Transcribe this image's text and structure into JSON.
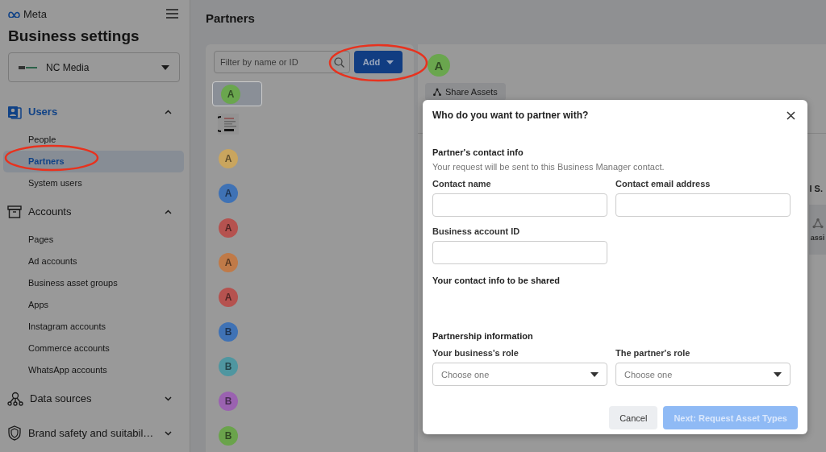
{
  "sidebar": {
    "logo": "Meta",
    "title": "Business settings",
    "business_selector": {
      "name": "NC Media"
    },
    "sections": [
      {
        "label": "Users",
        "expanded": true,
        "selected": true,
        "items": [
          {
            "label": "People",
            "selected": false
          },
          {
            "label": "Partners",
            "selected": true
          },
          {
            "label": "System users",
            "selected": false
          }
        ]
      },
      {
        "label": "Accounts",
        "expanded": true,
        "selected": false,
        "items": [
          {
            "label": "Pages",
            "selected": false
          },
          {
            "label": "Ad accounts",
            "selected": false
          },
          {
            "label": "Business asset groups",
            "selected": false
          },
          {
            "label": "Apps",
            "selected": false
          },
          {
            "label": "Instagram accounts",
            "selected": false
          },
          {
            "label": "Commerce accounts",
            "selected": false
          },
          {
            "label": "WhatsApp accounts",
            "selected": false
          }
        ]
      },
      {
        "label": "Data sources",
        "expanded": false,
        "selected": false
      },
      {
        "label": "Brand safety and suitabil…",
        "expanded": false,
        "selected": false
      }
    ]
  },
  "main": {
    "title": "Partners",
    "filter": {
      "placeholder": "Filter by name or ID"
    },
    "add_button": "Add",
    "partners": [
      {
        "kind": "avatar",
        "letter": "A",
        "color": "#6aa64e",
        "selected": true
      },
      {
        "kind": "picture",
        "selected": false
      },
      {
        "kind": "avatar",
        "letter": "A",
        "color": "#c9a55e",
        "selected": false
      },
      {
        "kind": "avatar",
        "letter": "A",
        "color": "#3f72b5",
        "selected": false
      },
      {
        "kind": "avatar",
        "letter": "A",
        "color": "#b5524f",
        "selected": false
      },
      {
        "kind": "avatar",
        "letter": "A",
        "color": "#c07a48",
        "selected": false
      },
      {
        "kind": "avatar",
        "letter": "A",
        "color": "#b5524f",
        "selected": false
      },
      {
        "kind": "avatar",
        "letter": "B",
        "color": "#3f72b5",
        "selected": false
      },
      {
        "kind": "avatar",
        "letter": "B",
        "color": "#4f96a0",
        "selected": false
      },
      {
        "kind": "avatar",
        "letter": "B",
        "color": "#9a62b0",
        "selected": false
      },
      {
        "kind": "avatar",
        "letter": "B",
        "color": "#6aa34b",
        "selected": false
      }
    ],
    "detail": {
      "letter": "A",
      "color": "#6aa64e",
      "share_button": "Share Assets",
      "column_text": "I S.",
      "card_text": "assi"
    }
  },
  "modal": {
    "title": "Who do you want to partner with?",
    "partner_contact": {
      "heading": "Partner's contact info",
      "note": "Your request will be sent to this Business Manager contact.",
      "fields": [
        {
          "label": "Contact name"
        },
        {
          "label": "Contact email address"
        },
        {
          "label": "Business account ID"
        }
      ]
    },
    "own_contact": {
      "heading": "Your contact info to be shared"
    },
    "partnership": {
      "heading": "Partnership information",
      "selects": [
        {
          "label": "Your business's role",
          "placeholder": "Choose one"
        },
        {
          "label": "The partner's role",
          "placeholder": "Choose one"
        }
      ]
    },
    "buttons": [
      {
        "label": "Cancel",
        "kind": "secondary",
        "disabled": false
      },
      {
        "label": "Next: Request Asset Types",
        "kind": "primary",
        "disabled": true
      }
    ]
  }
}
